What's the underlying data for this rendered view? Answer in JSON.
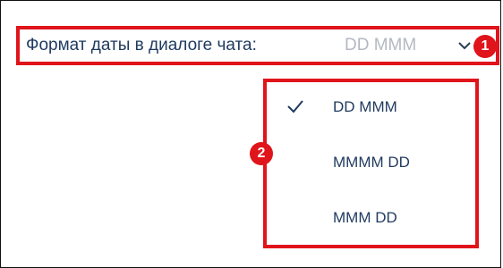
{
  "setting": {
    "label": "Формат даты в диалоге чата:",
    "current_value": "DD MMM",
    "chevron_icon": "chevron-down-icon"
  },
  "markers": {
    "first": "1",
    "second": "2"
  },
  "dropdown": {
    "options": [
      {
        "label": "DD MMM",
        "selected": true,
        "icon": "check-icon"
      },
      {
        "label": "MMMM DD",
        "selected": false
      },
      {
        "label": "MMM DD",
        "selected": false
      }
    ]
  },
  "colors": {
    "highlight": "#e0141b",
    "label_text": "#1f3a5f",
    "value_text": "#b3b9c1",
    "background": "#ffffff"
  }
}
